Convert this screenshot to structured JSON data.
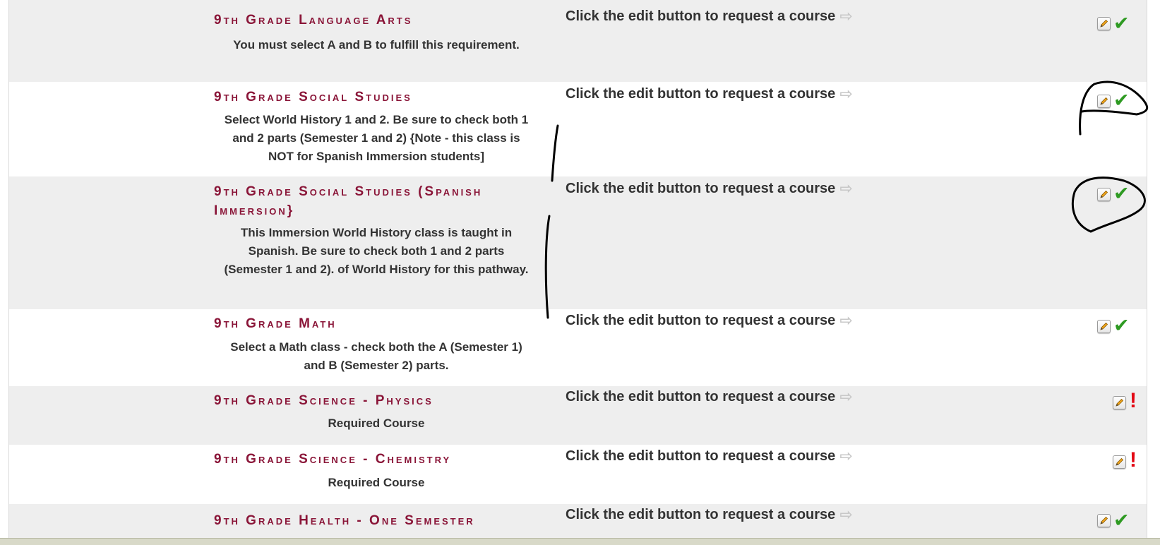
{
  "request_prompt": "Click the edit button to request a course",
  "icons": {
    "request_arrow": "right-arrow-icon",
    "edit": "pencil-edit-icon",
    "complete": "checkmark-icon",
    "incomplete": "exclamation-icon"
  },
  "colors": {
    "title": "#8a1538",
    "row_shade": "#eeeeee",
    "check": "#2e9a22",
    "warning": "#e30613"
  },
  "requirements": [
    {
      "title": "9th Grade Language Arts",
      "description": "You must select A and B to fulfill this requirement.",
      "status": "complete"
    },
    {
      "title": "9th Grade Social Studies",
      "description": "Select World History 1 and 2. Be sure to check both 1 and 2 parts (Semester 1 and 2) {Note - this class is NOT for Spanish Immersion students]",
      "status": "complete"
    },
    {
      "title": "9th Grade Social Studies (Spanish Immersion}",
      "description": "This Immersion World History class is taught in Spanish. Be sure to check both 1 and 2 parts (Semester 1 and 2). of World History for this pathway.",
      "status": "complete"
    },
    {
      "title": "9th Grade Math",
      "description": "Select a Math class - check both the A (Semester 1) and B (Semester 2) parts.",
      "status": "complete"
    },
    {
      "title": "9th Grade Science - Physics",
      "description": "Required Course",
      "status": "incomplete"
    },
    {
      "title": "9th Grade Science - Chemistry",
      "description": "Required Course",
      "status": "incomplete"
    },
    {
      "title": "9th Grade Health - One Semester",
      "description": "",
      "status": "complete"
    }
  ]
}
